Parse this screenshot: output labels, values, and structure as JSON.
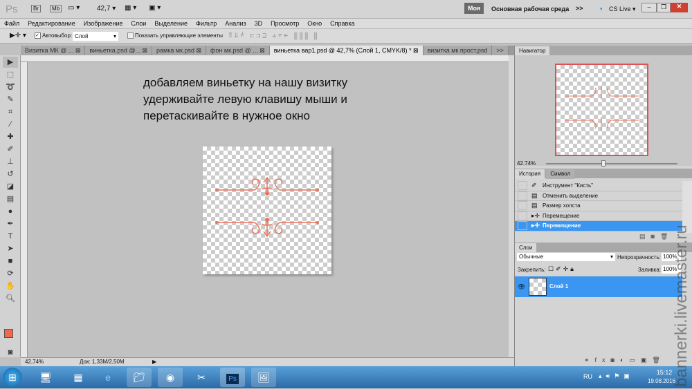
{
  "appbar": {
    "logo": "Ps",
    "br": "Br",
    "mb": "Mb",
    "zoom": "42,7",
    "workspace_active": "Моя",
    "workspace": "Основная рабочая среда",
    "more": ">>",
    "cslive": "CS Live"
  },
  "menu": [
    "Файл",
    "Редактирование",
    "Изображение",
    "Слои",
    "Выделение",
    "Фильтр",
    "Анализ",
    "3D",
    "Просмотр",
    "Окно",
    "Справка"
  ],
  "options": {
    "autoselect_label": "Автовыбор:",
    "autoselect_value": "Слой",
    "show_controls": "Показать управляющие элементы"
  },
  "tabs": [
    {
      "label": "Визитка МК @ ...",
      "active": false
    },
    {
      "label": "виньетка.psd @...",
      "active": false
    },
    {
      "label": "рамка мк.psd",
      "active": false
    },
    {
      "label": "фон мк.psd @ ...",
      "active": false
    },
    {
      "label": "виньетка вар1.psd @ 42,7% (Слой 1, CMYK/8) *",
      "active": true
    },
    {
      "label": "визитка мк прост.psd",
      "active": false
    }
  ],
  "tabs_more": ">>",
  "canvas_note": [
    "добавляем виньетку на нашу визитку",
    "удерживайте левую клавишу мыши и",
    "перетаскивайте в нужное окно"
  ],
  "status": {
    "zoom": "42,74%",
    "doc": "Док: 1,33M/2,50M"
  },
  "navigator": {
    "title": "Навигатор",
    "zoom": "42.74%"
  },
  "history": {
    "tab": "История",
    "tab2": "Символ",
    "items": [
      {
        "label": "Инструмент \"Кисть\"",
        "icon": "brush-icon"
      },
      {
        "label": "Отменить выделение",
        "icon": "document-icon"
      },
      {
        "label": "Размер холста",
        "icon": "document-icon"
      },
      {
        "label": "Перемещение",
        "icon": "move-icon"
      },
      {
        "label": "Перемещение",
        "icon": "move-icon",
        "selected": true
      }
    ]
  },
  "layers": {
    "tab": "Слои",
    "blend": "Обычные",
    "opacity_label": "Непрозрачность:",
    "opacity": "100%",
    "lock_label": "Закрепить:",
    "fill_label": "Заливка:",
    "fill": "100%",
    "layer": "Слой 1"
  },
  "taskbar": {
    "lang": "RU",
    "time": "15:12",
    "date": "19.08.2016"
  },
  "watermark": "bannerki.livemaster.ru",
  "colors": {
    "accent": "#3a96f0",
    "foreground": "#f06a4a",
    "ornament": "#e8735a"
  }
}
